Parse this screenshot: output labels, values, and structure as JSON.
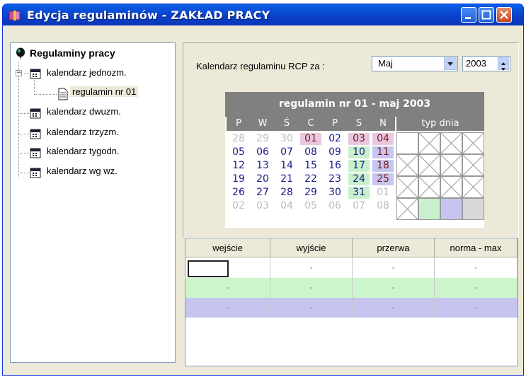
{
  "window": {
    "title": "Edycja regulaminów - ZAKŁAD PRACY",
    "accent": "#0a50d8"
  },
  "tree": {
    "root": "Regulaminy pracy",
    "items": [
      {
        "label": "kalendarz jednozm.",
        "expanded": true,
        "children": [
          {
            "label": "regulamin nr 01",
            "selected": true
          }
        ]
      },
      {
        "label": "kalendarz dwuzm."
      },
      {
        "label": "kalendarz trzyzm."
      },
      {
        "label": "kalendarz tygodn."
      },
      {
        "label": "kalendarz wg wz."
      }
    ]
  },
  "header": {
    "rcp_label": "Kalendarz regulaminu RCP  za :",
    "month": "Maj",
    "year": "2003"
  },
  "calendar": {
    "title": "regulamin nr 01 - maj 2003",
    "weekdays": [
      "P",
      "W",
      "Ś",
      "C",
      "P",
      "S",
      "N"
    ],
    "typ_label": "typ dnia",
    "weeks": [
      [
        {
          "d": "28",
          "t": "other"
        },
        {
          "d": "29",
          "t": "other"
        },
        {
          "d": "30",
          "t": "other"
        },
        {
          "d": "01",
          "t": "holiday"
        },
        {
          "d": "02",
          "t": "work"
        },
        {
          "d": "03",
          "t": "holiday"
        },
        {
          "d": "04",
          "t": "holiday"
        }
      ],
      [
        {
          "d": "05",
          "t": "work"
        },
        {
          "d": "06",
          "t": "work"
        },
        {
          "d": "07",
          "t": "work"
        },
        {
          "d": "08",
          "t": "work"
        },
        {
          "d": "09",
          "t": "work"
        },
        {
          "d": "10",
          "t": "sat"
        },
        {
          "d": "11",
          "t": "sun"
        }
      ],
      [
        {
          "d": "12",
          "t": "work"
        },
        {
          "d": "13",
          "t": "work"
        },
        {
          "d": "14",
          "t": "work"
        },
        {
          "d": "15",
          "t": "work"
        },
        {
          "d": "16",
          "t": "work"
        },
        {
          "d": "17",
          "t": "sat"
        },
        {
          "d": "18",
          "t": "sun"
        }
      ],
      [
        {
          "d": "19",
          "t": "work"
        },
        {
          "d": "20",
          "t": "work"
        },
        {
          "d": "21",
          "t": "work"
        },
        {
          "d": "22",
          "t": "work"
        },
        {
          "d": "23",
          "t": "work"
        },
        {
          "d": "24",
          "t": "sat"
        },
        {
          "d": "25",
          "t": "sun"
        }
      ],
      [
        {
          "d": "26",
          "t": "work"
        },
        {
          "d": "27",
          "t": "work"
        },
        {
          "d": "28",
          "t": "work"
        },
        {
          "d": "29",
          "t": "work"
        },
        {
          "d": "30",
          "t": "work"
        },
        {
          "d": "31",
          "t": "sat"
        },
        {
          "d": "01",
          "t": "other"
        }
      ],
      [
        {
          "d": "02",
          "t": "other"
        },
        {
          "d": "03",
          "t": "other"
        },
        {
          "d": "04",
          "t": "other"
        },
        {
          "d": "05",
          "t": "other"
        },
        {
          "d": "06",
          "t": "other"
        },
        {
          "d": "07",
          "t": "other"
        },
        {
          "d": "08",
          "t": "other"
        }
      ]
    ],
    "typ_swatches": [
      "#ffffff",
      "#c8f0cc",
      "#c5c5f0",
      "#d8d8d8"
    ]
  },
  "grid": {
    "columns": [
      "wejście",
      "wyjście",
      "przerwa",
      "norma - max"
    ],
    "rows": [
      {
        "color": "#ffffff",
        "cells": [
          "",
          "-",
          "-",
          "-"
        ]
      },
      {
        "color": "#ccf5cc",
        "cells": [
          "-",
          "-",
          "-",
          "-"
        ]
      },
      {
        "color": "#c5c5f0",
        "cells": [
          "-",
          "-",
          "-",
          "-"
        ]
      }
    ]
  }
}
